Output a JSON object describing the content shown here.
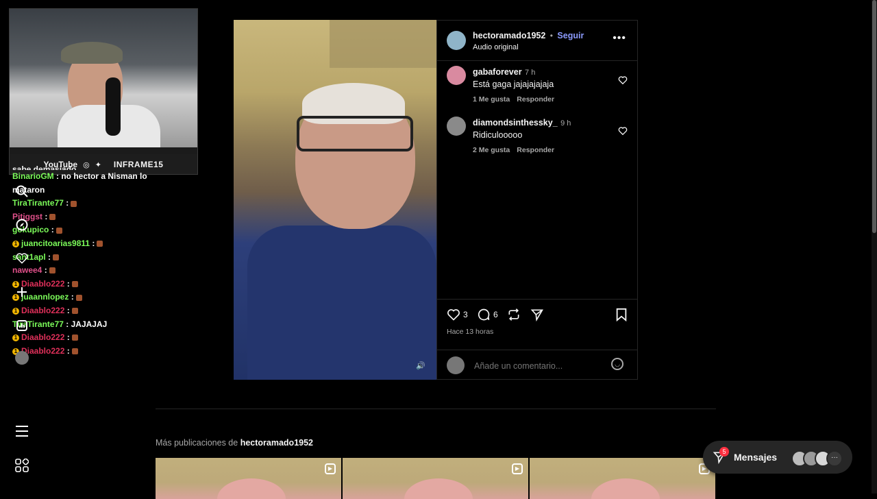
{
  "webcam": {
    "banner_youtube": "YouTube",
    "banner_name": "INFRAME15"
  },
  "chat": {
    "partial_top": "sabe demasiado",
    "messages": [
      {
        "user": "BinarioGM",
        "text": ": no hector a Nisman lo mataron",
        "user_color": "#7CFC5A",
        "emote": false,
        "badge": false
      },
      {
        "user": "TiraTirante77",
        "text": ":",
        "user_color": "#7CFC5A",
        "emote": true,
        "badge": false
      },
      {
        "user": "Pitiggst",
        "text": ":",
        "user_color": "#e0508a",
        "emote": true,
        "badge": false
      },
      {
        "user": "gokupico",
        "text": ":",
        "user_color": "#7CFC5A",
        "emote": true,
        "badge": false
      },
      {
        "user": "juancitoarias9811",
        "text": ":",
        "user_color": "#7CFC5A",
        "emote": true,
        "badge": true
      },
      {
        "user": "sant1apl",
        "text": ":",
        "user_color": "#7CFC5A",
        "emote": true,
        "badge": false
      },
      {
        "user": "nawee4",
        "text": ":",
        "user_color": "#e0508a",
        "emote": true,
        "badge": false
      },
      {
        "user": "Diaablo222",
        "text": ":",
        "user_color": "#e0305a",
        "emote": true,
        "badge": true
      },
      {
        "user": "juaannlopez",
        "text": ":",
        "user_color": "#7CFC5A",
        "emote": true,
        "badge": true
      },
      {
        "user": "Diaablo222",
        "text": ":",
        "user_color": "#e0305a",
        "emote": true,
        "badge": true
      },
      {
        "user": "TiraTirante77",
        "text": ": JAJAJAJ",
        "user_color": "#7CFC5A",
        "emote": false,
        "badge": false
      },
      {
        "user": "Diaablo222",
        "text": ":",
        "user_color": "#e0305a",
        "emote": true,
        "badge": true
      },
      {
        "user": "Diaablo222",
        "text": ":",
        "user_color": "#e0305a",
        "emote": true,
        "badge": true
      }
    ]
  },
  "post": {
    "author": "hectoramado1952",
    "separator": "•",
    "follow_label": "Seguir",
    "audio_label": "Audio original",
    "more_icon": "more-horizontal-icon",
    "comments": [
      {
        "user": "gabaforever",
        "time": "7 h",
        "text": "Está gaga jajajajajaja",
        "likes": "1 Me gusta",
        "reply": "Responder",
        "avatar_color": "#d98aa0"
      },
      {
        "user": "diamondsinthessky_",
        "time": "9 h",
        "text": "Ridiculooooo",
        "likes": "2 Me gusta",
        "reply": "Responder",
        "avatar_color": "#8a8a8a"
      }
    ],
    "like_count": "3",
    "comment_count": "6",
    "posted_time": "Hace 13 horas",
    "add_comment_placeholder": "Añade un comentario..."
  },
  "more_posts": {
    "prefix": "Más publicaciones de",
    "author": "hectoramado1952"
  },
  "messages_bar": {
    "label": "Mensajes",
    "badge": "5"
  },
  "colors": {
    "background": "#000000",
    "accent": "#8c9bff",
    "text": "#f5f5f5",
    "muted": "#a8a8a8",
    "badge_red": "#ff3040"
  }
}
